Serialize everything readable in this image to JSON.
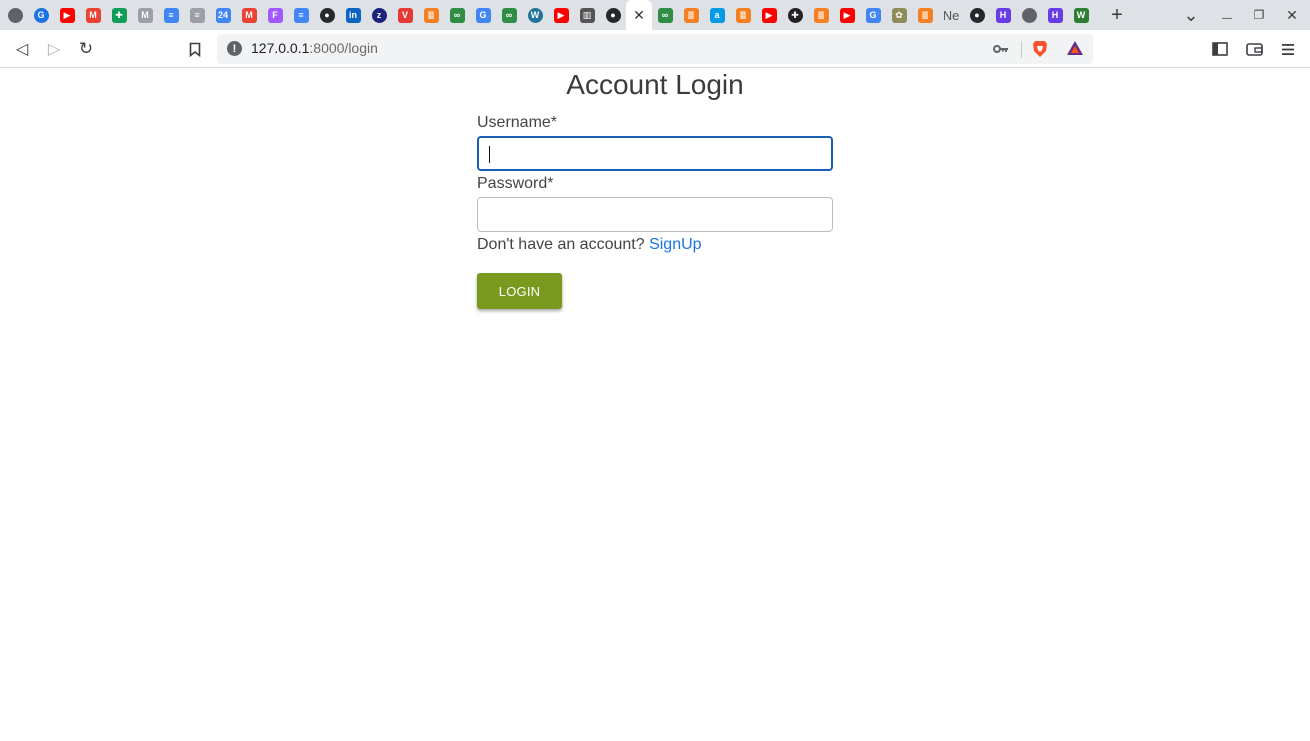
{
  "browser": {
    "tabs": [
      {
        "icon": "globe-icon",
        "glyph": "",
        "color": "#5f6368",
        "round": true
      },
      {
        "icon": "google-icon",
        "glyph": "G",
        "color": "#1a73e8",
        "round": true
      },
      {
        "icon": "youtube-icon",
        "glyph": "▶",
        "color": "#ff0000"
      },
      {
        "icon": "gmail-icon",
        "glyph": "M",
        "color": "#ea4335"
      },
      {
        "icon": "sheets-icon",
        "glyph": "✚",
        "color": "#0f9d58"
      },
      {
        "icon": "gmail-gray-icon",
        "glyph": "M",
        "color": "#9aa0a6"
      },
      {
        "icon": "docs-icon",
        "glyph": "≡",
        "color": "#4285f4"
      },
      {
        "icon": "docs-gray-icon",
        "glyph": "≡",
        "color": "#9aa0a6"
      },
      {
        "icon": "calendar-icon",
        "glyph": "24",
        "color": "#4285f4"
      },
      {
        "icon": "gmail-icon",
        "glyph": "M",
        "color": "#ea4335"
      },
      {
        "icon": "figma-icon",
        "glyph": "F",
        "color": "#a259ff"
      },
      {
        "icon": "docs-icon",
        "glyph": "≡",
        "color": "#4285f4"
      },
      {
        "icon": "github-icon",
        "glyph": "●",
        "color": "#24292e",
        "round": true
      },
      {
        "icon": "linkedin-icon",
        "glyph": "in",
        "color": "#0a66c2"
      },
      {
        "icon": "app-blue-icon",
        "glyph": "z",
        "color": "#1a237e",
        "round": true
      },
      {
        "icon": "vivaldi-icon",
        "glyph": "V",
        "color": "#e53935"
      },
      {
        "icon": "stackoverflow-icon",
        "glyph": "≣",
        "color": "#f48024"
      },
      {
        "icon": "geeksforgeeks-icon",
        "glyph": "∞",
        "color": "#2f8d46"
      },
      {
        "icon": "google-icon",
        "glyph": "G",
        "color": "#4285f4"
      },
      {
        "icon": "geeksforgeeks-icon",
        "glyph": "∞",
        "color": "#2f8d46"
      },
      {
        "icon": "wordpress-icon",
        "glyph": "W",
        "color": "#21759b",
        "round": true
      },
      {
        "icon": "youtube-icon",
        "glyph": "▶",
        "color": "#ff0000"
      },
      {
        "icon": "book-icon",
        "glyph": "▥",
        "color": "#555555"
      },
      {
        "icon": "github-icon",
        "glyph": "●",
        "color": "#24292e",
        "round": true
      },
      {
        "icon": "close-tab-icon",
        "glyph": "✕",
        "color": "#ffffff",
        "active": true
      },
      {
        "icon": "geeksforgeeks-icon",
        "glyph": "∞",
        "color": "#2f8d46"
      },
      {
        "icon": "stackoverflow-icon",
        "glyph": "≣",
        "color": "#f48024"
      },
      {
        "icon": "app-cyan-icon",
        "glyph": "a",
        "color": "#039be5"
      },
      {
        "icon": "stackoverflow-icon",
        "glyph": "≣",
        "color": "#f48024"
      },
      {
        "icon": "youtube-icon",
        "glyph": "▶",
        "color": "#ff0000"
      },
      {
        "icon": "circle-app-icon",
        "glyph": "✚",
        "color": "#222222",
        "round": true
      },
      {
        "icon": "stackoverflow-icon",
        "glyph": "≣",
        "color": "#f48024"
      },
      {
        "icon": "youtube-icon",
        "glyph": "▶",
        "color": "#ff0000"
      },
      {
        "icon": "google-icon",
        "glyph": "G",
        "color": "#4285f4"
      },
      {
        "icon": "plant-icon",
        "glyph": "✿",
        "color": "#8d8d5a"
      },
      {
        "icon": "stackoverflow-icon",
        "glyph": "≣",
        "color": "#f48024"
      },
      {
        "icon": "netflix-text-icon",
        "glyph": "Ne",
        "color": "#555555",
        "plain": true
      },
      {
        "icon": "github-icon",
        "glyph": "●",
        "color": "#24292e",
        "round": true
      },
      {
        "icon": "hostinger-icon",
        "glyph": "H",
        "color": "#673de6"
      },
      {
        "icon": "globe-icon",
        "glyph": "",
        "color": "#5f6368",
        "round": true
      },
      {
        "icon": "hostinger-icon",
        "glyph": "H",
        "color": "#673de6"
      },
      {
        "icon": "webflow-icon",
        "glyph": "W",
        "color": "#2e7d32"
      }
    ],
    "new_tab_glyph": "+",
    "tab_search_glyph": "⌄",
    "minimize_glyph": "—",
    "restore_glyph": "❐",
    "close_glyph": "✕",
    "back_glyph": "◁",
    "forward_glyph": "▷",
    "reload_glyph": "↻",
    "bookmark_glyph": "🔖",
    "url_host": "127.0.0.1",
    "url_rest": ":8000/login",
    "info_glyph": "!",
    "key_glyph": "⚷",
    "sidebar_glyph": "◧",
    "wallet_glyph": "▣",
    "menu_glyph": "☰"
  },
  "login": {
    "title": "Account Login",
    "username_label": "Username*",
    "username_value": "",
    "password_label": "Password*",
    "password_value": "",
    "signup_prompt": "Don't have an account?",
    "signup_link": "SignUp",
    "login_button": "LOGIN"
  },
  "colors": {
    "login_button": "#7a9a1f",
    "link": "#1a73e8",
    "focus_ring": "#1a5fb4"
  }
}
